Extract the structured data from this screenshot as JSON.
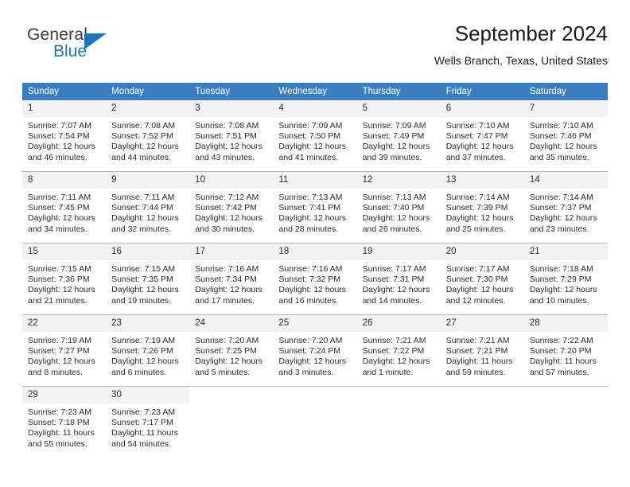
{
  "brand": {
    "name_top": "General",
    "name_bottom": "Blue",
    "accent_color": "#1b75bb",
    "logo_icon": "triangle-icon"
  },
  "header": {
    "title": "September 2024",
    "subtitle": "Wells Branch, Texas, United States"
  },
  "calendar": {
    "header_bg": "#3a7ec0",
    "daynum_bg": "#f2f2f2",
    "weekdays": [
      "Sunday",
      "Monday",
      "Tuesday",
      "Wednesday",
      "Thursday",
      "Friday",
      "Saturday"
    ],
    "weeks": [
      [
        {
          "day": "1",
          "sunrise": "Sunrise: 7:07 AM",
          "sunset": "Sunset: 7:54 PM",
          "daylight_line1": "Daylight: 12 hours",
          "daylight_line2": "and 46 minutes."
        },
        {
          "day": "2",
          "sunrise": "Sunrise: 7:08 AM",
          "sunset": "Sunset: 7:52 PM",
          "daylight_line1": "Daylight: 12 hours",
          "daylight_line2": "and 44 minutes."
        },
        {
          "day": "3",
          "sunrise": "Sunrise: 7:08 AM",
          "sunset": "Sunset: 7:51 PM",
          "daylight_line1": "Daylight: 12 hours",
          "daylight_line2": "and 43 minutes."
        },
        {
          "day": "4",
          "sunrise": "Sunrise: 7:09 AM",
          "sunset": "Sunset: 7:50 PM",
          "daylight_line1": "Daylight: 12 hours",
          "daylight_line2": "and 41 minutes."
        },
        {
          "day": "5",
          "sunrise": "Sunrise: 7:09 AM",
          "sunset": "Sunset: 7:49 PM",
          "daylight_line1": "Daylight: 12 hours",
          "daylight_line2": "and 39 minutes."
        },
        {
          "day": "6",
          "sunrise": "Sunrise: 7:10 AM",
          "sunset": "Sunset: 7:47 PM",
          "daylight_line1": "Daylight: 12 hours",
          "daylight_line2": "and 37 minutes."
        },
        {
          "day": "7",
          "sunrise": "Sunrise: 7:10 AM",
          "sunset": "Sunset: 7:46 PM",
          "daylight_line1": "Daylight: 12 hours",
          "daylight_line2": "and 35 minutes."
        }
      ],
      [
        {
          "day": "8",
          "sunrise": "Sunrise: 7:11 AM",
          "sunset": "Sunset: 7:45 PM",
          "daylight_line1": "Daylight: 12 hours",
          "daylight_line2": "and 34 minutes."
        },
        {
          "day": "9",
          "sunrise": "Sunrise: 7:11 AM",
          "sunset": "Sunset: 7:44 PM",
          "daylight_line1": "Daylight: 12 hours",
          "daylight_line2": "and 32 minutes."
        },
        {
          "day": "10",
          "sunrise": "Sunrise: 7:12 AM",
          "sunset": "Sunset: 7:42 PM",
          "daylight_line1": "Daylight: 12 hours",
          "daylight_line2": "and 30 minutes."
        },
        {
          "day": "11",
          "sunrise": "Sunrise: 7:13 AM",
          "sunset": "Sunset: 7:41 PM",
          "daylight_line1": "Daylight: 12 hours",
          "daylight_line2": "and 28 minutes."
        },
        {
          "day": "12",
          "sunrise": "Sunrise: 7:13 AM",
          "sunset": "Sunset: 7:40 PM",
          "daylight_line1": "Daylight: 12 hours",
          "daylight_line2": "and 26 minutes."
        },
        {
          "day": "13",
          "sunrise": "Sunrise: 7:14 AM",
          "sunset": "Sunset: 7:39 PM",
          "daylight_line1": "Daylight: 12 hours",
          "daylight_line2": "and 25 minutes."
        },
        {
          "day": "14",
          "sunrise": "Sunrise: 7:14 AM",
          "sunset": "Sunset: 7:37 PM",
          "daylight_line1": "Daylight: 12 hours",
          "daylight_line2": "and 23 minutes."
        }
      ],
      [
        {
          "day": "15",
          "sunrise": "Sunrise: 7:15 AM",
          "sunset": "Sunset: 7:36 PM",
          "daylight_line1": "Daylight: 12 hours",
          "daylight_line2": "and 21 minutes."
        },
        {
          "day": "16",
          "sunrise": "Sunrise: 7:15 AM",
          "sunset": "Sunset: 7:35 PM",
          "daylight_line1": "Daylight: 12 hours",
          "daylight_line2": "and 19 minutes."
        },
        {
          "day": "17",
          "sunrise": "Sunrise: 7:16 AM",
          "sunset": "Sunset: 7:34 PM",
          "daylight_line1": "Daylight: 12 hours",
          "daylight_line2": "and 17 minutes."
        },
        {
          "day": "18",
          "sunrise": "Sunrise: 7:16 AM",
          "sunset": "Sunset: 7:32 PM",
          "daylight_line1": "Daylight: 12 hours",
          "daylight_line2": "and 16 minutes."
        },
        {
          "day": "19",
          "sunrise": "Sunrise: 7:17 AM",
          "sunset": "Sunset: 7:31 PM",
          "daylight_line1": "Daylight: 12 hours",
          "daylight_line2": "and 14 minutes."
        },
        {
          "day": "20",
          "sunrise": "Sunrise: 7:17 AM",
          "sunset": "Sunset: 7:30 PM",
          "daylight_line1": "Daylight: 12 hours",
          "daylight_line2": "and 12 minutes."
        },
        {
          "day": "21",
          "sunrise": "Sunrise: 7:18 AM",
          "sunset": "Sunset: 7:29 PM",
          "daylight_line1": "Daylight: 12 hours",
          "daylight_line2": "and 10 minutes."
        }
      ],
      [
        {
          "day": "22",
          "sunrise": "Sunrise: 7:19 AM",
          "sunset": "Sunset: 7:27 PM",
          "daylight_line1": "Daylight: 12 hours",
          "daylight_line2": "and 8 minutes."
        },
        {
          "day": "23",
          "sunrise": "Sunrise: 7:19 AM",
          "sunset": "Sunset: 7:26 PM",
          "daylight_line1": "Daylight: 12 hours",
          "daylight_line2": "and 6 minutes."
        },
        {
          "day": "24",
          "sunrise": "Sunrise: 7:20 AM",
          "sunset": "Sunset: 7:25 PM",
          "daylight_line1": "Daylight: 12 hours",
          "daylight_line2": "and 5 minutes."
        },
        {
          "day": "25",
          "sunrise": "Sunrise: 7:20 AM",
          "sunset": "Sunset: 7:24 PM",
          "daylight_line1": "Daylight: 12 hours",
          "daylight_line2": "and 3 minutes."
        },
        {
          "day": "26",
          "sunrise": "Sunrise: 7:21 AM",
          "sunset": "Sunset: 7:22 PM",
          "daylight_line1": "Daylight: 12 hours",
          "daylight_line2": "and 1 minute."
        },
        {
          "day": "27",
          "sunrise": "Sunrise: 7:21 AM",
          "sunset": "Sunset: 7:21 PM",
          "daylight_line1": "Daylight: 11 hours",
          "daylight_line2": "and 59 minutes."
        },
        {
          "day": "28",
          "sunrise": "Sunrise: 7:22 AM",
          "sunset": "Sunset: 7:20 PM",
          "daylight_line1": "Daylight: 11 hours",
          "daylight_line2": "and 57 minutes."
        }
      ],
      [
        {
          "day": "29",
          "sunrise": "Sunrise: 7:23 AM",
          "sunset": "Sunset: 7:18 PM",
          "daylight_line1": "Daylight: 11 hours",
          "daylight_line2": "and 55 minutes."
        },
        {
          "day": "30",
          "sunrise": "Sunrise: 7:23 AM",
          "sunset": "Sunset: 7:17 PM",
          "daylight_line1": "Daylight: 11 hours",
          "daylight_line2": "and 54 minutes."
        },
        {
          "day": "",
          "sunrise": "",
          "sunset": "",
          "daylight_line1": "",
          "daylight_line2": ""
        },
        {
          "day": "",
          "sunrise": "",
          "sunset": "",
          "daylight_line1": "",
          "daylight_line2": ""
        },
        {
          "day": "",
          "sunrise": "",
          "sunset": "",
          "daylight_line1": "",
          "daylight_line2": ""
        },
        {
          "day": "",
          "sunrise": "",
          "sunset": "",
          "daylight_line1": "",
          "daylight_line2": ""
        },
        {
          "day": "",
          "sunrise": "",
          "sunset": "",
          "daylight_line1": "",
          "daylight_line2": ""
        }
      ]
    ]
  }
}
